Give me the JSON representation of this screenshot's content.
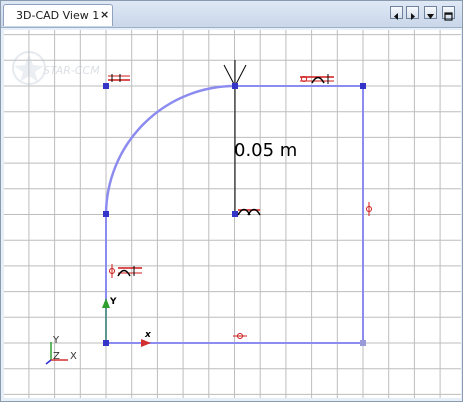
{
  "tab": {
    "label": "3D-CAD View 1",
    "close_symbol": "×"
  },
  "watermark": "STAR-CCM",
  "dimension": {
    "label": "0.05 m"
  },
  "sketch_axes": {
    "x_label": "x",
    "y_label": "Y"
  },
  "triad": {
    "x_label": "X",
    "y_label": "Y",
    "z_label": "Z"
  },
  "colors": {
    "sketch_line": "#8c8cf0",
    "vertex": "#3434c8",
    "grid": "#bdbdbd",
    "constraint": "#d01818",
    "dimension_line": "#000000"
  },
  "icons": [
    "tab-close-icon",
    "scroll-left-icon",
    "scroll-right-icon",
    "dropdown-icon",
    "maximize-icon",
    "star-ccm-logo"
  ]
}
